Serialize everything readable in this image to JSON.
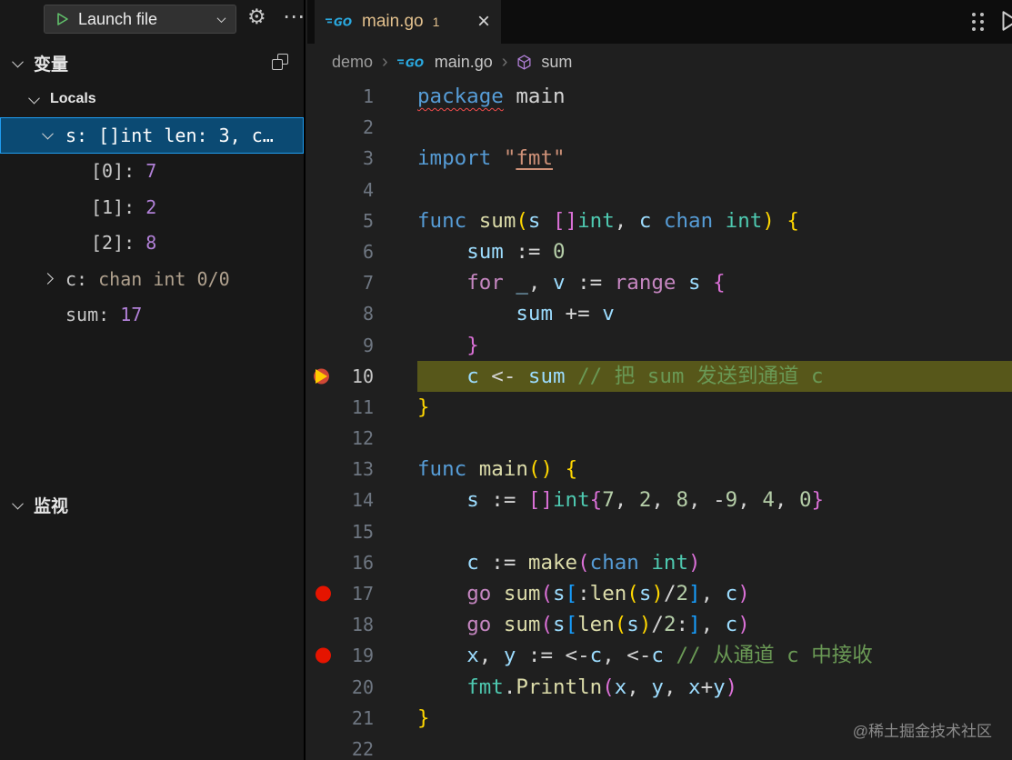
{
  "debug_toolbar": {
    "launch_label": "Launch file"
  },
  "icons": {
    "gear": "⚙",
    "more": "⋯",
    "close": "×",
    "separator": "›"
  },
  "sidebar": {
    "variables_header": "变量",
    "locals_label": "Locals",
    "watch_header": "监视",
    "variables": [
      {
        "level": 1,
        "chevron": "down",
        "name": "s:",
        "value": "[]int len: 3, c…",
        "value_class": "vplain",
        "selected": true
      },
      {
        "level": 2,
        "chevron": null,
        "name": "[0]:",
        "value": "7",
        "value_class": "vnum",
        "selected": false
      },
      {
        "level": 2,
        "chevron": null,
        "name": "[1]:",
        "value": "2",
        "value_class": "vnum",
        "selected": false
      },
      {
        "level": 2,
        "chevron": null,
        "name": "[2]:",
        "value": "8",
        "value_class": "vnum",
        "selected": false
      },
      {
        "level": 1,
        "chevron": "right",
        "name": "c:",
        "value": "chan int 0/0",
        "value_class": "vtype",
        "selected": false
      },
      {
        "level": 1,
        "chevron": null,
        "name": "sum:",
        "value": "17",
        "value_class": "vnum",
        "selected": false
      }
    ]
  },
  "editor": {
    "go_icon_text": "GO",
    "tab": {
      "label": "main.go",
      "badge": "1"
    },
    "breadcrumb": {
      "folder": "demo",
      "file": "main.go",
      "symbol": "sum"
    },
    "lines": [
      {
        "n": 1,
        "tokens": [
          [
            "kwe",
            "package"
          ],
          [
            "pln",
            " main"
          ]
        ]
      },
      {
        "n": 2,
        "tokens": []
      },
      {
        "n": 3,
        "tokens": [
          [
            "kw",
            "import"
          ],
          [
            "pln",
            " "
          ],
          [
            "str",
            "\""
          ],
          [
            "stru",
            "fmt"
          ],
          [
            "str",
            "\""
          ]
        ]
      },
      {
        "n": 4,
        "tokens": []
      },
      {
        "n": 5,
        "tokens": [
          [
            "kw",
            "func"
          ],
          [
            "pln",
            " "
          ],
          [
            "fn",
            "sum"
          ],
          [
            "b1",
            "("
          ],
          [
            "vr",
            "s"
          ],
          [
            "pln",
            " "
          ],
          [
            "b2",
            "[]"
          ],
          [
            "ty",
            "int"
          ],
          [
            "pln",
            ", "
          ],
          [
            "vr",
            "c"
          ],
          [
            "pln",
            " "
          ],
          [
            "kw",
            "chan"
          ],
          [
            "pln",
            " "
          ],
          [
            "ty",
            "int"
          ],
          [
            "b1",
            ")"
          ],
          [
            "pln",
            " "
          ],
          [
            "b1",
            "{"
          ]
        ]
      },
      {
        "n": 6,
        "tokens": [
          [
            "pln",
            "    "
          ],
          [
            "vr",
            "sum"
          ],
          [
            "pln",
            " := "
          ],
          [
            "nm",
            "0"
          ]
        ]
      },
      {
        "n": 7,
        "tokens": [
          [
            "pln",
            "    "
          ],
          [
            "ct",
            "for"
          ],
          [
            "pln",
            " "
          ],
          [
            "vr",
            "_"
          ],
          [
            "pln",
            ", "
          ],
          [
            "vr",
            "v"
          ],
          [
            "pln",
            " := "
          ],
          [
            "ct",
            "range"
          ],
          [
            "pln",
            " "
          ],
          [
            "vr",
            "s"
          ],
          [
            "pln",
            " "
          ],
          [
            "b2",
            "{"
          ]
        ]
      },
      {
        "n": 8,
        "tokens": [
          [
            "pln",
            "        "
          ],
          [
            "vr",
            "sum"
          ],
          [
            "pln",
            " += "
          ],
          [
            "vr",
            "v"
          ]
        ]
      },
      {
        "n": 9,
        "tokens": [
          [
            "pln",
            "    "
          ],
          [
            "b2",
            "}"
          ]
        ]
      },
      {
        "n": 10,
        "current": true,
        "breakpoint": true,
        "tokens": [
          [
            "pln",
            "    "
          ],
          [
            "vr",
            "c"
          ],
          [
            "pln",
            " <- "
          ],
          [
            "vr",
            "sum"
          ],
          [
            "pln",
            " "
          ],
          [
            "cm",
            "// 把 sum 发送到通道 c"
          ]
        ]
      },
      {
        "n": 11,
        "tokens": [
          [
            "b1",
            "}"
          ]
        ]
      },
      {
        "n": 12,
        "tokens": []
      },
      {
        "n": 13,
        "tokens": [
          [
            "kw",
            "func"
          ],
          [
            "pln",
            " "
          ],
          [
            "fn",
            "main"
          ],
          [
            "b1",
            "()"
          ],
          [
            "pln",
            " "
          ],
          [
            "b1",
            "{"
          ]
        ]
      },
      {
        "n": 14,
        "tokens": [
          [
            "pln",
            "    "
          ],
          [
            "vr",
            "s"
          ],
          [
            "pln",
            " := "
          ],
          [
            "b2",
            "[]"
          ],
          [
            "ty",
            "int"
          ],
          [
            "b2",
            "{"
          ],
          [
            "nm",
            "7"
          ],
          [
            "pln",
            ", "
          ],
          [
            "nm",
            "2"
          ],
          [
            "pln",
            ", "
          ],
          [
            "nm",
            "8"
          ],
          [
            "pln",
            ", -"
          ],
          [
            "nm",
            "9"
          ],
          [
            "pln",
            ", "
          ],
          [
            "nm",
            "4"
          ],
          [
            "pln",
            ", "
          ],
          [
            "nm",
            "0"
          ],
          [
            "b2",
            "}"
          ]
        ]
      },
      {
        "n": 15,
        "tokens": []
      },
      {
        "n": 16,
        "tokens": [
          [
            "pln",
            "    "
          ],
          [
            "vr",
            "c"
          ],
          [
            "pln",
            " := "
          ],
          [
            "fn",
            "make"
          ],
          [
            "b2",
            "("
          ],
          [
            "kw",
            "chan"
          ],
          [
            "pln",
            " "
          ],
          [
            "ty",
            "int"
          ],
          [
            "b2",
            ")"
          ]
        ]
      },
      {
        "n": 17,
        "breakpoint": true,
        "tokens": [
          [
            "pln",
            "    "
          ],
          [
            "ct",
            "go"
          ],
          [
            "pln",
            " "
          ],
          [
            "fn",
            "sum"
          ],
          [
            "b2",
            "("
          ],
          [
            "vr",
            "s"
          ],
          [
            "b3",
            "["
          ],
          [
            "pln",
            ":"
          ],
          [
            "fn",
            "len"
          ],
          [
            "b1",
            "("
          ],
          [
            "vr",
            "s"
          ],
          [
            "b1",
            ")"
          ],
          [
            "pln",
            "/"
          ],
          [
            "nm",
            "2"
          ],
          [
            "b3",
            "]"
          ],
          [
            "pln",
            ", "
          ],
          [
            "vr",
            "c"
          ],
          [
            "b2",
            ")"
          ]
        ]
      },
      {
        "n": 18,
        "tokens": [
          [
            "pln",
            "    "
          ],
          [
            "ct",
            "go"
          ],
          [
            "pln",
            " "
          ],
          [
            "fn",
            "sum"
          ],
          [
            "b2",
            "("
          ],
          [
            "vr",
            "s"
          ],
          [
            "b3",
            "["
          ],
          [
            "fn",
            "len"
          ],
          [
            "b1",
            "("
          ],
          [
            "vr",
            "s"
          ],
          [
            "b1",
            ")"
          ],
          [
            "pln",
            "/"
          ],
          [
            "nm",
            "2"
          ],
          [
            "pln",
            ":"
          ],
          [
            "b3",
            "]"
          ],
          [
            "pln",
            ", "
          ],
          [
            "vr",
            "c"
          ],
          [
            "b2",
            ")"
          ]
        ]
      },
      {
        "n": 19,
        "breakpoint": true,
        "tokens": [
          [
            "pln",
            "    "
          ],
          [
            "vr",
            "x"
          ],
          [
            "pln",
            ", "
          ],
          [
            "vr",
            "y"
          ],
          [
            "pln",
            " := <-"
          ],
          [
            "vr",
            "c"
          ],
          [
            "pln",
            ", <-"
          ],
          [
            "vr",
            "c"
          ],
          [
            "pln",
            " "
          ],
          [
            "cm",
            "// 从通道 c 中接收"
          ]
        ]
      },
      {
        "n": 20,
        "tokens": [
          [
            "pln",
            "    "
          ],
          [
            "ty",
            "fmt"
          ],
          [
            "pln",
            "."
          ],
          [
            "fn",
            "Println"
          ],
          [
            "b2",
            "("
          ],
          [
            "vr",
            "x"
          ],
          [
            "pln",
            ", "
          ],
          [
            "vr",
            "y"
          ],
          [
            "pln",
            ", "
          ],
          [
            "vr",
            "x"
          ],
          [
            "pln",
            "+"
          ],
          [
            "vr",
            "y"
          ],
          [
            "b2",
            ")"
          ]
        ]
      },
      {
        "n": 21,
        "tokens": [
          [
            "b1",
            "}"
          ]
        ]
      },
      {
        "n": 22,
        "tokens": []
      }
    ]
  },
  "watermark": "@稀土掘金技术社区"
}
